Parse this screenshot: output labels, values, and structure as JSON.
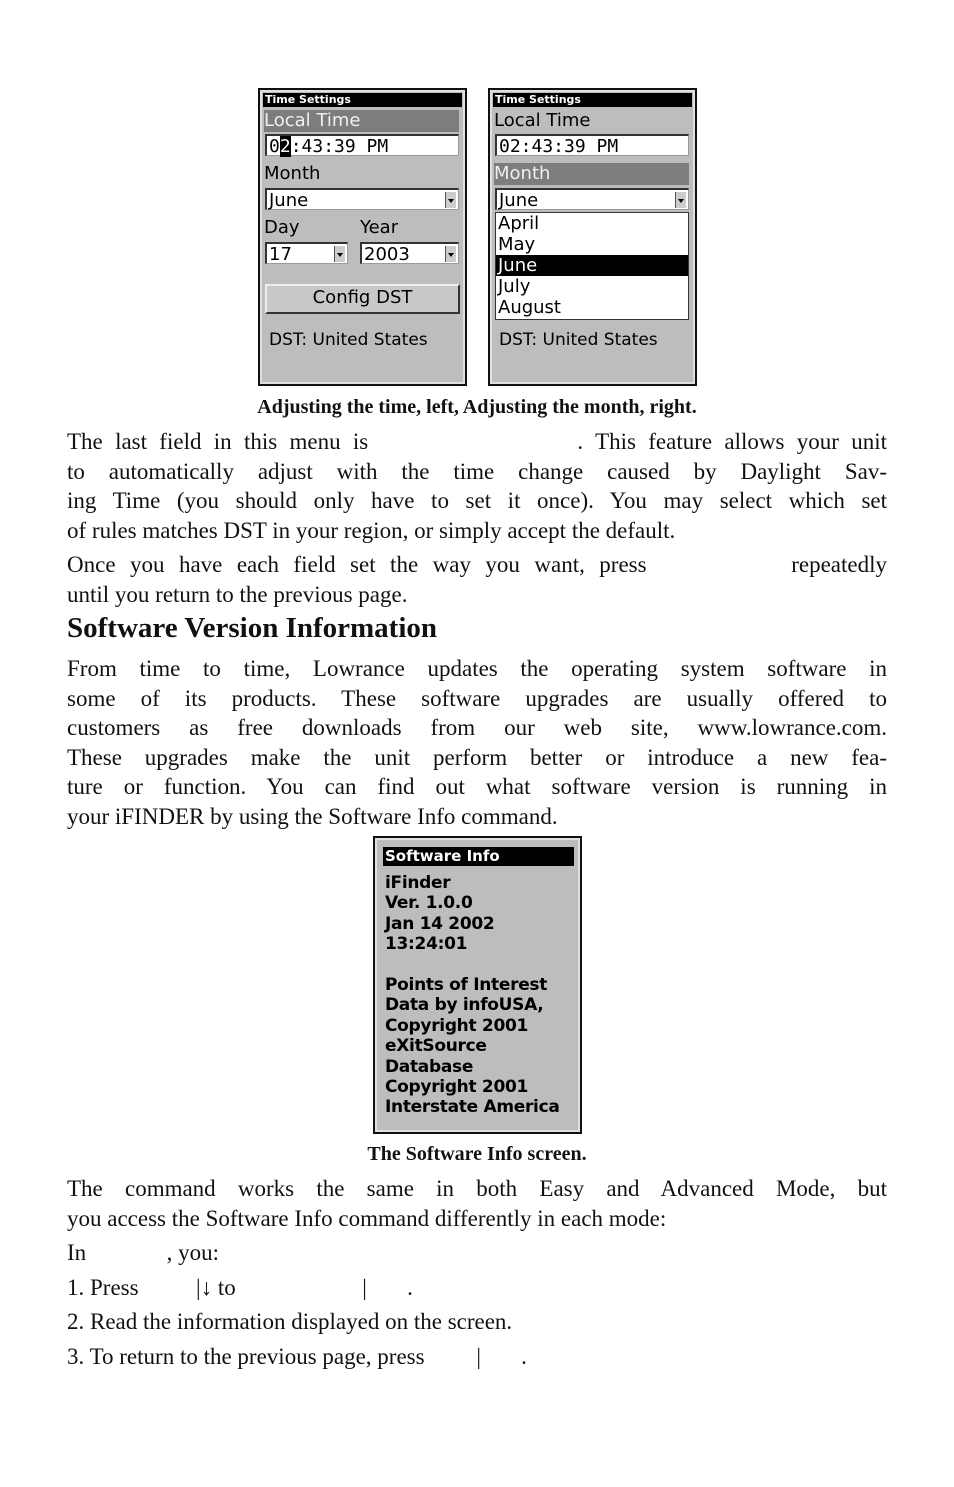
{
  "screens": {
    "left": {
      "title": "Time Settings",
      "local_time_label": "Local Time",
      "time_first_digit": "0",
      "time_cursor_digit": "2",
      "time_rest": ":43:39 PM",
      "month_label": "Month",
      "month_value": "June",
      "day_label": "Day",
      "day_value": "17",
      "year_label": "Year",
      "year_value": "2003",
      "config_button": "Config DST",
      "dst_status": "DST: United States"
    },
    "right": {
      "title": "Time Settings",
      "local_time_label": "Local Time",
      "time_value": "02:43:39 PM",
      "month_label": "Month",
      "month_value": "June",
      "month_options": [
        "April",
        "May",
        "June",
        "July",
        "August"
      ],
      "selected_option": "June",
      "dst_status": "DST: United States"
    },
    "software": {
      "title": "Software Info",
      "lines": [
        "iFinder",
        "Ver. 1.0.0",
        "Jan 14 2002",
        "13:24:01",
        "",
        "Points of Interest",
        "Data by infoUSA,",
        "Copyright 2001",
        "eXitSource",
        "Database",
        "Copyright 2001",
        "Interstate America"
      ]
    }
  },
  "captions": {
    "time_screens": "Adjusting the time, left, Adjusting the month, right.",
    "software_screen": "The Software Info screen."
  },
  "body": {
    "p1": [
      "The last field in this menu is                 . This feature allows your unit",
      "to automatically adjust with the time change caused by Daylight Sav-",
      "ing Time (you should only have to set it once). You may select which set",
      "of rules matches DST in your region, or simply accept the default."
    ],
    "p2": [
      "Once you have each field set the way you want, press          repeatedly",
      "until you return to the previous page."
    ],
    "heading": "Software Version Information",
    "p3": [
      "From time to time, Lowrance updates the operating system software in",
      "some of its products. These software upgrades are usually offered to",
      "customers as free downloads from our web site, www.lowrance.com.",
      "These upgrades make the unit perform better or introduce a new fea-",
      "ture or function. You can find out what software version is running in",
      "your iFINDER by using the Software Info command."
    ],
    "p4": [
      "The command works the same in both Easy and Advanced Mode, but",
      "you access the Software Info command differently in each mode:"
    ],
    "in_mode": "In              , you:",
    "step1": "1. Press          |↓ to                      |       .",
    "step2": "2. Read the information displayed on the screen.",
    "step3": "3. To return to the previous page, press         |       ."
  }
}
